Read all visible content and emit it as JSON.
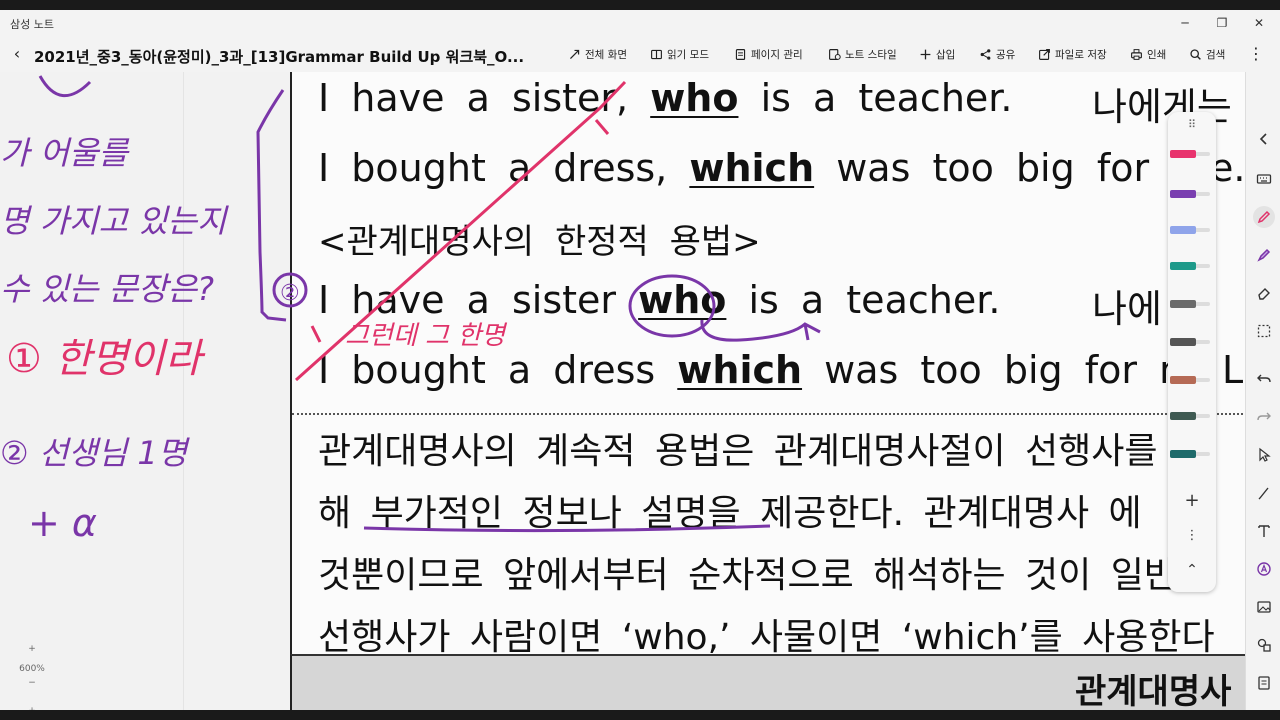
{
  "app": {
    "title": "삼성 노트"
  },
  "window": {
    "minimize": "─",
    "maximize": "❐",
    "close": "✕"
  },
  "toolbar": {
    "back": "‹",
    "doc_title": "2021년_중3_동아(윤정미)_3과_[13]Grammar Build Up 워크북_O...",
    "tools": [
      "전체 화면",
      "읽기 모드",
      "페이지 관리",
      "노트 스타일",
      "삽입",
      "공유",
      "파일로 저장",
      "인쇄",
      "검색"
    ],
    "more": "⋮"
  },
  "page": {
    "lines": [
      {
        "pre": "I have a sister,",
        "kw": "who",
        "post": "is a teacher.",
        "kor": "나에게는"
      },
      {
        "pre": "I bought a dress,",
        "kw": "which",
        "post": "was too big for",
        "kor": "e."
      },
      {
        "heading": "<관계대명사의 한정적 용법>"
      },
      {
        "pre": "I have a sister",
        "kw": "who",
        "post": "is a teacher.",
        "kor": "나에"
      },
      {
        "pre": "I bought a dress",
        "kw": "which",
        "post": "was too big for m",
        "kor": "L"
      }
    ],
    "korean": [
      "관계대명사의 계속적 용법은 관계대명사절이 선행사를",
      "해 부가적인 정보나 설명을 제공한다. 관계대명사 에",
      "것뿐이므로 앞에서부터 순차적으로 해석하는 것이 일반",
      "선행사가 사람이면 ‘who,’ 사물이면 ‘which’를 사용한다"
    ],
    "next_heading": "관계대명사"
  },
  "handwriting": {
    "left": [
      "가 어울를",
      "명 가지고 있는지",
      "수 있는 문장은?",
      "① 한명이라",
      "② 선생님 1명",
      "+ α"
    ],
    "circle_1": "①",
    "circle_2": "②",
    "annotation": "그런데 그 한명"
  },
  "zoom": {
    "plus": "+",
    "level": "600%",
    "minus": "−"
  },
  "pen_panel": {
    "drag": "⠿",
    "pens": [
      {
        "color": "#e8336d"
      },
      {
        "color": "#7a3fb0"
      },
      {
        "color": "#8fa4ea"
      },
      {
        "color": "#1e9a8a"
      },
      {
        "color": "#6b6b6b"
      },
      {
        "color": "#555555"
      },
      {
        "color": "#b56a55"
      },
      {
        "color": "#3f5a52"
      },
      {
        "color": "#1f6b6b"
      }
    ],
    "add": "+",
    "more": "⋮",
    "collapse": "⌃"
  },
  "colors": {
    "pink_ink": "#e0336a",
    "purple_ink": "#7a36a8"
  }
}
